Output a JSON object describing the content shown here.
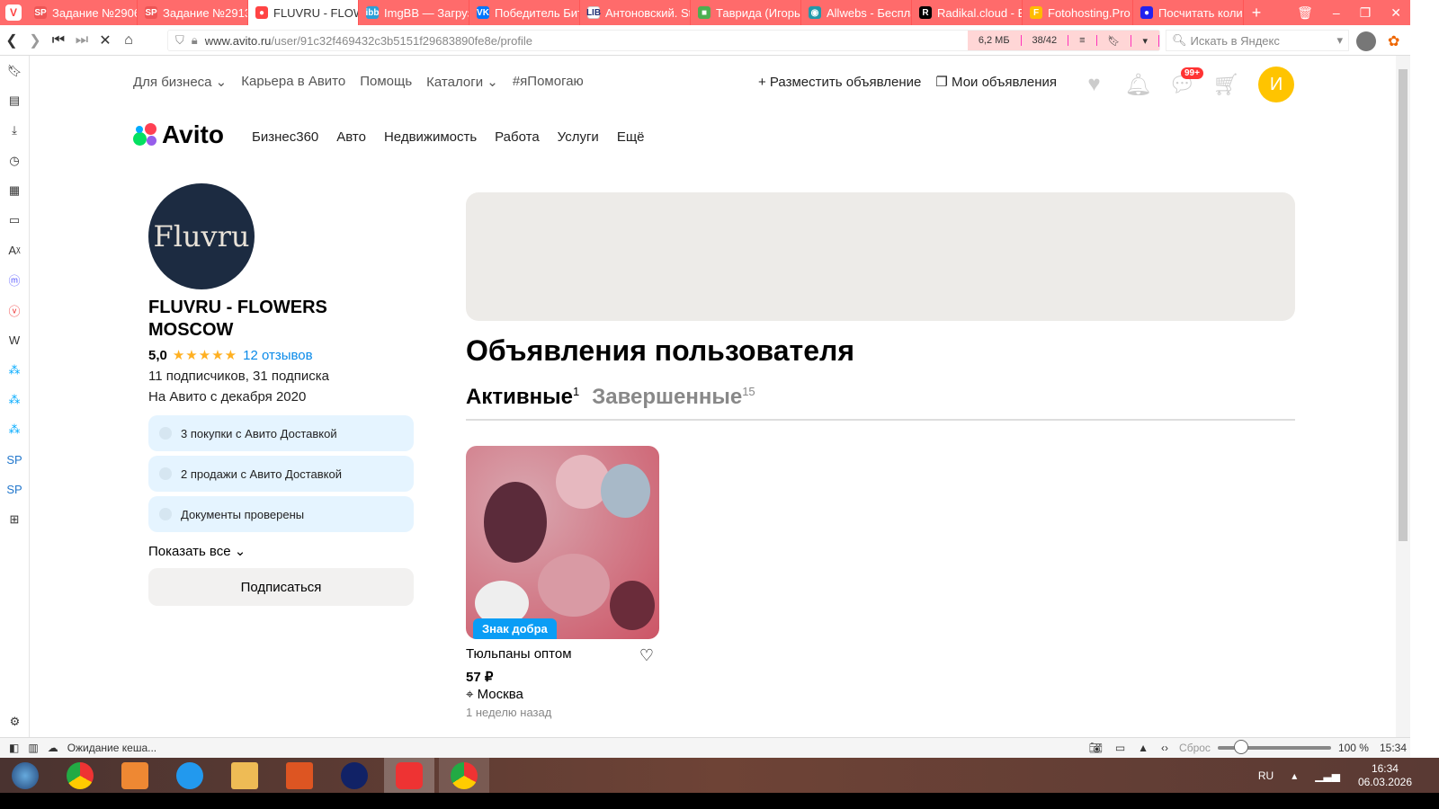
{
  "browser": {
    "tabs": [
      {
        "label": "Задание №2906",
        "icon": "SP",
        "color": "#e55"
      },
      {
        "label": "Задание №2913",
        "icon": "SP",
        "color": "#e55"
      },
      {
        "label": "FLUVRU - FLOWERS",
        "icon": "●",
        "color": "#f44",
        "active": true
      },
      {
        "label": "ImgBB — Загрузка",
        "icon": "ibb",
        "color": "#2a9fd8"
      },
      {
        "label": "Победитель Битвы",
        "icon": "VK",
        "color": "#07f"
      },
      {
        "label": "Антоновский. St",
        "icon": "LIB",
        "color": "#fff"
      },
      {
        "label": "Таврида (Игорь",
        "icon": "■",
        "color": "#4caf50"
      },
      {
        "label": "Allwebs - Бесплатно",
        "icon": "◉",
        "color": "#29a"
      },
      {
        "label": "Radikal.cloud - Б",
        "icon": "R",
        "color": "#000"
      },
      {
        "label": "Fotohosting.Pro",
        "icon": "F",
        "color": "#fb0"
      },
      {
        "label": "Посчитать колич",
        "icon": "●",
        "color": "#22e"
      }
    ],
    "url_domain": "www.avito.ru",
    "url_path": "/user/91c32f469432c3b5151f29683890fe8e/profile",
    "page_size": "6,2 МБ",
    "page_count": "38/42",
    "search_placeholder": "Искать в Яндекс",
    "status_text": "Ожидание кеша...",
    "zoom_reset": "Сброс",
    "zoom_level": "100 %",
    "status_time": "15:34"
  },
  "site": {
    "topnav": [
      "Для бизнеса ⌄",
      "Карьера в Авито",
      "Помощь",
      "Каталоги ⌄",
      "#яПомогаю"
    ],
    "post_ad": "+ Разместить объявление",
    "my_ads": "Мои объявления",
    "messages_badge": "99+",
    "avatar_letter": "И",
    "logo": "Avito",
    "categories": [
      "Бизнес360",
      "Авто",
      "Недвижимость",
      "Работа",
      "Услуги",
      "Ещё"
    ]
  },
  "profile": {
    "avatar_text": "Fluvru",
    "name": "FLUVRU - FLOWERS MOSCOW",
    "rating": "5,0",
    "stars": "★★★★★",
    "reviews": "12 отзывов",
    "subs": "11 подписчиков, 31 подписка",
    "since": "На Авито с декабря 2020",
    "badges": [
      "3 покупки с Авито Доставкой",
      "2 продажи с Авито Доставкой",
      "Документы проверены"
    ],
    "show_all": "Показать все ⌄",
    "subscribe": "Подписаться"
  },
  "listings": {
    "title": "Объявления пользователя",
    "tab_active": "Активные",
    "tab_active_count": "1",
    "tab_done": "Завершенные",
    "tab_done_count": "15",
    "items": [
      {
        "badge": "Знак добра",
        "title": "Тюльпаны оптом",
        "price": "57 ₽",
        "location": "Москва",
        "ago": "1 неделю назад"
      }
    ]
  },
  "taskbar": {
    "lang": "RU",
    "time": "16:34",
    "date": "06.03.2026"
  }
}
